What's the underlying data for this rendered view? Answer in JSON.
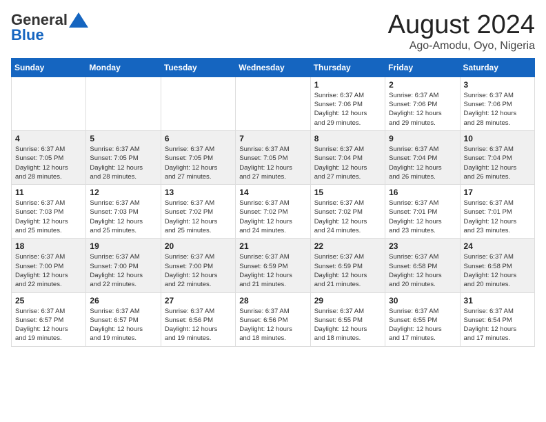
{
  "logo": {
    "general": "General",
    "blue": "Blue"
  },
  "header": {
    "month": "August 2024",
    "location": "Ago-Amodu, Oyo, Nigeria"
  },
  "weekdays": [
    "Sunday",
    "Monday",
    "Tuesday",
    "Wednesday",
    "Thursday",
    "Friday",
    "Saturday"
  ],
  "weeks": [
    [
      {
        "day": "",
        "info": ""
      },
      {
        "day": "",
        "info": ""
      },
      {
        "day": "",
        "info": ""
      },
      {
        "day": "",
        "info": ""
      },
      {
        "day": "1",
        "info": "Sunrise: 6:37 AM\nSunset: 7:06 PM\nDaylight: 12 hours\nand 29 minutes."
      },
      {
        "day": "2",
        "info": "Sunrise: 6:37 AM\nSunset: 7:06 PM\nDaylight: 12 hours\nand 29 minutes."
      },
      {
        "day": "3",
        "info": "Sunrise: 6:37 AM\nSunset: 7:06 PM\nDaylight: 12 hours\nand 28 minutes."
      }
    ],
    [
      {
        "day": "4",
        "info": "Sunrise: 6:37 AM\nSunset: 7:05 PM\nDaylight: 12 hours\nand 28 minutes."
      },
      {
        "day": "5",
        "info": "Sunrise: 6:37 AM\nSunset: 7:05 PM\nDaylight: 12 hours\nand 28 minutes."
      },
      {
        "day": "6",
        "info": "Sunrise: 6:37 AM\nSunset: 7:05 PM\nDaylight: 12 hours\nand 27 minutes."
      },
      {
        "day": "7",
        "info": "Sunrise: 6:37 AM\nSunset: 7:05 PM\nDaylight: 12 hours\nand 27 minutes."
      },
      {
        "day": "8",
        "info": "Sunrise: 6:37 AM\nSunset: 7:04 PM\nDaylight: 12 hours\nand 27 minutes."
      },
      {
        "day": "9",
        "info": "Sunrise: 6:37 AM\nSunset: 7:04 PM\nDaylight: 12 hours\nand 26 minutes."
      },
      {
        "day": "10",
        "info": "Sunrise: 6:37 AM\nSunset: 7:04 PM\nDaylight: 12 hours\nand 26 minutes."
      }
    ],
    [
      {
        "day": "11",
        "info": "Sunrise: 6:37 AM\nSunset: 7:03 PM\nDaylight: 12 hours\nand 25 minutes."
      },
      {
        "day": "12",
        "info": "Sunrise: 6:37 AM\nSunset: 7:03 PM\nDaylight: 12 hours\nand 25 minutes."
      },
      {
        "day": "13",
        "info": "Sunrise: 6:37 AM\nSunset: 7:02 PM\nDaylight: 12 hours\nand 25 minutes."
      },
      {
        "day": "14",
        "info": "Sunrise: 6:37 AM\nSunset: 7:02 PM\nDaylight: 12 hours\nand 24 minutes."
      },
      {
        "day": "15",
        "info": "Sunrise: 6:37 AM\nSunset: 7:02 PM\nDaylight: 12 hours\nand 24 minutes."
      },
      {
        "day": "16",
        "info": "Sunrise: 6:37 AM\nSunset: 7:01 PM\nDaylight: 12 hours\nand 23 minutes."
      },
      {
        "day": "17",
        "info": "Sunrise: 6:37 AM\nSunset: 7:01 PM\nDaylight: 12 hours\nand 23 minutes."
      }
    ],
    [
      {
        "day": "18",
        "info": "Sunrise: 6:37 AM\nSunset: 7:00 PM\nDaylight: 12 hours\nand 22 minutes."
      },
      {
        "day": "19",
        "info": "Sunrise: 6:37 AM\nSunset: 7:00 PM\nDaylight: 12 hours\nand 22 minutes."
      },
      {
        "day": "20",
        "info": "Sunrise: 6:37 AM\nSunset: 7:00 PM\nDaylight: 12 hours\nand 22 minutes."
      },
      {
        "day": "21",
        "info": "Sunrise: 6:37 AM\nSunset: 6:59 PM\nDaylight: 12 hours\nand 21 minutes."
      },
      {
        "day": "22",
        "info": "Sunrise: 6:37 AM\nSunset: 6:59 PM\nDaylight: 12 hours\nand 21 minutes."
      },
      {
        "day": "23",
        "info": "Sunrise: 6:37 AM\nSunset: 6:58 PM\nDaylight: 12 hours\nand 20 minutes."
      },
      {
        "day": "24",
        "info": "Sunrise: 6:37 AM\nSunset: 6:58 PM\nDaylight: 12 hours\nand 20 minutes."
      }
    ],
    [
      {
        "day": "25",
        "info": "Sunrise: 6:37 AM\nSunset: 6:57 PM\nDaylight: 12 hours\nand 19 minutes."
      },
      {
        "day": "26",
        "info": "Sunrise: 6:37 AM\nSunset: 6:57 PM\nDaylight: 12 hours\nand 19 minutes."
      },
      {
        "day": "27",
        "info": "Sunrise: 6:37 AM\nSunset: 6:56 PM\nDaylight: 12 hours\nand 19 minutes."
      },
      {
        "day": "28",
        "info": "Sunrise: 6:37 AM\nSunset: 6:56 PM\nDaylight: 12 hours\nand 18 minutes."
      },
      {
        "day": "29",
        "info": "Sunrise: 6:37 AM\nSunset: 6:55 PM\nDaylight: 12 hours\nand 18 minutes."
      },
      {
        "day": "30",
        "info": "Sunrise: 6:37 AM\nSunset: 6:55 PM\nDaylight: 12 hours\nand 17 minutes."
      },
      {
        "day": "31",
        "info": "Sunrise: 6:37 AM\nSunset: 6:54 PM\nDaylight: 12 hours\nand 17 minutes."
      }
    ]
  ]
}
